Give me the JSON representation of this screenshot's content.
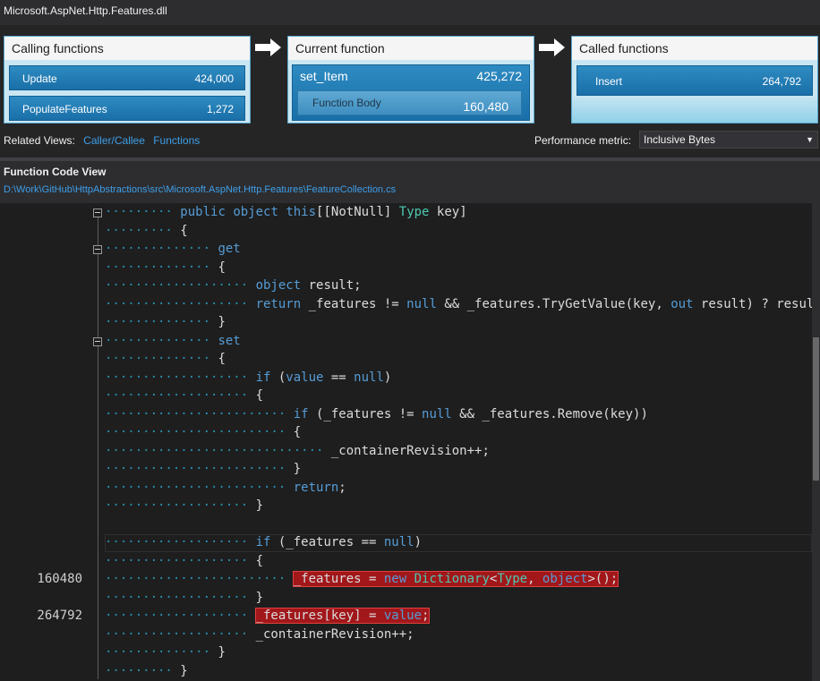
{
  "window": {
    "title": "Microsoft.AspNet.Http.Features.dll"
  },
  "calling": {
    "header": "Calling functions",
    "items": [
      {
        "name": "Update",
        "value": "424,000"
      },
      {
        "name": "PopulateFeatures",
        "value": "1,272"
      }
    ]
  },
  "current": {
    "header": "Current function",
    "name": "set_Item",
    "value": "425,272",
    "body_label": "Function Body",
    "body_value": "160,480"
  },
  "called": {
    "header": "Called functions",
    "items": [
      {
        "name": "Insert",
        "value": "264,792"
      }
    ]
  },
  "related": {
    "label": "Related Views:",
    "links": [
      "Caller/Callee",
      "Functions"
    ]
  },
  "metric": {
    "label": "Performance metric:",
    "selected": "Inclusive Bytes"
  },
  "code_view": {
    "title": "Function Code View",
    "path": "D:\\Work\\GitHub\\HttpAbstractions\\src\\Microsoft.AspNet.Http.Features\\FeatureCollection.cs"
  },
  "code": {
    "lines": [
      {
        "num": "",
        "indent": 2,
        "tokens": [
          [
            "kw",
            "public"
          ],
          [
            "p",
            " "
          ],
          [
            "kw",
            "object"
          ],
          [
            "p",
            " "
          ],
          [
            "kw",
            "this"
          ],
          [
            "p",
            "[[NotNull] "
          ],
          [
            "ty",
            "Type"
          ],
          [
            "p",
            " key]"
          ]
        ]
      },
      {
        "num": "",
        "indent": 2,
        "tokens": [
          [
            "p",
            "{"
          ]
        ]
      },
      {
        "num": "",
        "indent": 3,
        "tokens": [
          [
            "kw",
            "get"
          ]
        ]
      },
      {
        "num": "",
        "indent": 3,
        "tokens": [
          [
            "p",
            "{"
          ]
        ]
      },
      {
        "num": "",
        "indent": 4,
        "tokens": [
          [
            "kw",
            "object"
          ],
          [
            "p",
            " result;"
          ]
        ]
      },
      {
        "num": "",
        "indent": 4,
        "tokens": [
          [
            "kw",
            "return"
          ],
          [
            "p",
            " _features != "
          ],
          [
            "kw",
            "null"
          ],
          [
            "p",
            " && _features.TryGetValue(key, "
          ],
          [
            "kw",
            "out"
          ],
          [
            "p",
            " result) ? result"
          ]
        ]
      },
      {
        "num": "",
        "indent": 3,
        "tokens": [
          [
            "p",
            "}"
          ]
        ]
      },
      {
        "num": "",
        "indent": 3,
        "tokens": [
          [
            "kw",
            "set"
          ]
        ]
      },
      {
        "num": "",
        "indent": 3,
        "tokens": [
          [
            "p",
            "{"
          ]
        ]
      },
      {
        "num": "",
        "indent": 4,
        "tokens": [
          [
            "kw",
            "if"
          ],
          [
            "p",
            " ("
          ],
          [
            "kw",
            "value"
          ],
          [
            "p",
            " == "
          ],
          [
            "kw",
            "null"
          ],
          [
            "p",
            ")"
          ]
        ]
      },
      {
        "num": "",
        "indent": 4,
        "tokens": [
          [
            "p",
            "{"
          ]
        ]
      },
      {
        "num": "",
        "indent": 5,
        "tokens": [
          [
            "kw",
            "if"
          ],
          [
            "p",
            " (_features != "
          ],
          [
            "kw",
            "null"
          ],
          [
            "p",
            " && _features.Remove(key))"
          ]
        ]
      },
      {
        "num": "",
        "indent": 5,
        "tokens": [
          [
            "p",
            "{"
          ]
        ]
      },
      {
        "num": "",
        "indent": 6,
        "tokens": [
          [
            "p",
            "_containerRevision++;"
          ]
        ]
      },
      {
        "num": "",
        "indent": 5,
        "tokens": [
          [
            "p",
            "}"
          ]
        ]
      },
      {
        "num": "",
        "indent": 5,
        "tokens": [
          [
            "kw",
            "return"
          ],
          [
            "p",
            ";"
          ]
        ]
      },
      {
        "num": "",
        "indent": 4,
        "tokens": [
          [
            "p",
            "}"
          ]
        ]
      },
      {
        "num": "",
        "indent": 0,
        "tokens": []
      },
      {
        "num": "",
        "indent": 4,
        "tokens": [
          [
            "kw",
            "if"
          ],
          [
            "p",
            " (_features == "
          ],
          [
            "kw",
            "null"
          ],
          [
            "p",
            ")"
          ]
        ]
      },
      {
        "num": "",
        "indent": 4,
        "tokens": [
          [
            "p",
            "{"
          ]
        ]
      },
      {
        "num": "160480",
        "indent": 5,
        "hot": true,
        "tokens": [
          [
            "p",
            "_features = "
          ],
          [
            "kw",
            "new"
          ],
          [
            "p",
            " "
          ],
          [
            "ty",
            "Dictionary"
          ],
          [
            "p",
            "<"
          ],
          [
            "ty",
            "Type"
          ],
          [
            "p",
            ", "
          ],
          [
            "kw",
            "object"
          ],
          [
            "p",
            ">();"
          ]
        ]
      },
      {
        "num": "",
        "indent": 4,
        "tokens": [
          [
            "p",
            "}"
          ]
        ]
      },
      {
        "num": "264792",
        "indent": 4,
        "hot": true,
        "tokens": [
          [
            "p",
            "_features[key] = "
          ],
          [
            "kw",
            "value"
          ],
          [
            "p",
            ";"
          ]
        ]
      },
      {
        "num": "",
        "indent": 4,
        "tokens": [
          [
            "p",
            "_containerRevision++;"
          ]
        ]
      },
      {
        "num": "",
        "indent": 3,
        "tokens": [
          [
            "p",
            "}"
          ]
        ]
      },
      {
        "num": "",
        "indent": 2,
        "tokens": [
          [
            "p",
            "}"
          ]
        ]
      }
    ]
  }
}
